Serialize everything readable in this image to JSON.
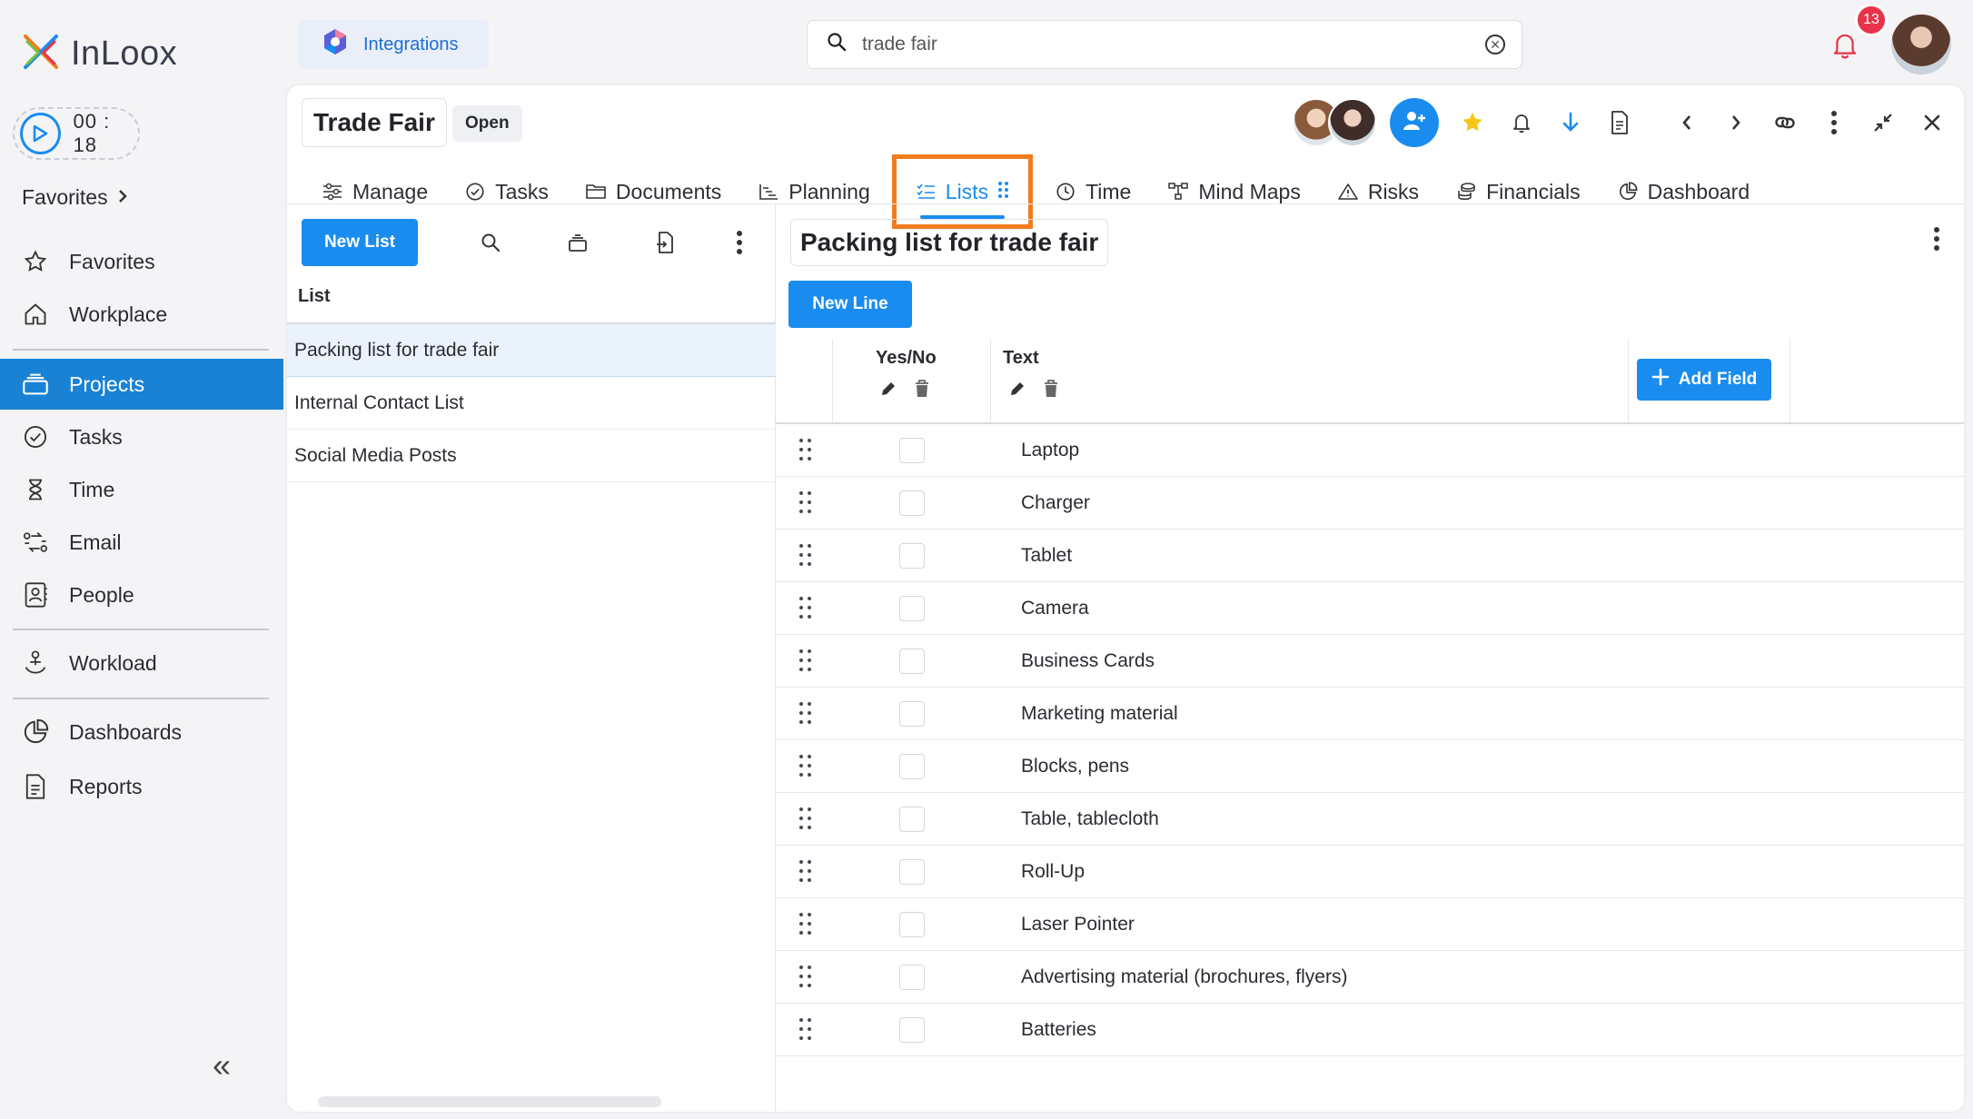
{
  "app": {
    "logo_text": "InLoox",
    "timer": "00 : 18",
    "favorites_header": "Favorites",
    "nav": [
      {
        "label": "Favorites",
        "icon": "star-icon"
      },
      {
        "label": "Workplace",
        "icon": "home-icon"
      },
      {
        "label": "Projects",
        "icon": "projects-icon",
        "active": true
      },
      {
        "label": "Tasks",
        "icon": "check-circle-icon"
      },
      {
        "label": "Time",
        "icon": "hourglass-icon"
      },
      {
        "label": "Email",
        "icon": "email-icon"
      },
      {
        "label": "People",
        "icon": "contact-icon"
      },
      {
        "label": "Workload",
        "icon": "workload-icon"
      },
      {
        "label": "Dashboards",
        "icon": "pie-chart-icon"
      },
      {
        "label": "Reports",
        "icon": "report-icon"
      }
    ],
    "collapse_glyph": "«"
  },
  "topbar": {
    "integrations_label": "Integrations",
    "search_value": "trade fair",
    "notification_count": "13"
  },
  "project": {
    "title": "Trade Fair",
    "status": "Open",
    "tabs": [
      {
        "label": "Manage",
        "icon": "sliders-icon"
      },
      {
        "label": "Tasks",
        "icon": "check-circle-icon"
      },
      {
        "label": "Documents",
        "icon": "folder-icon"
      },
      {
        "label": "Planning",
        "icon": "gantt-icon"
      },
      {
        "label": "Lists",
        "icon": "list-icon",
        "active": true
      },
      {
        "label": "Time",
        "icon": "clock-icon"
      },
      {
        "label": "Mind Maps",
        "icon": "mindmap-icon"
      },
      {
        "label": "Risks",
        "icon": "warning-icon"
      },
      {
        "label": "Financials",
        "icon": "coins-icon"
      },
      {
        "label": "Dashboard",
        "icon": "pie-chart-icon"
      }
    ]
  },
  "lists_pane": {
    "new_list_label": "New List",
    "column_header": "List",
    "items": [
      "Packing list for trade fair",
      "Internal Contact List",
      "Social Media Posts"
    ],
    "selected_index": 0
  },
  "detail": {
    "title": "Packing list for trade fair",
    "new_line_label": "New Line",
    "columns": [
      "Yes/No",
      "Text"
    ],
    "add_field_label": "Add Field",
    "rows": [
      "Laptop",
      "Charger",
      "Tablet",
      "Camera",
      "Business Cards",
      "Marketing material",
      "Blocks, pens",
      "Table, tablecloth",
      "Roll-Up",
      "Laser Pointer",
      "Advertising material (brochures, flyers)",
      "Batteries"
    ]
  },
  "colors": {
    "accent": "#1a8cef",
    "sidebar_active": "#1a82d4",
    "highlight_border": "#f07c1e",
    "badge": "#e8334a"
  }
}
